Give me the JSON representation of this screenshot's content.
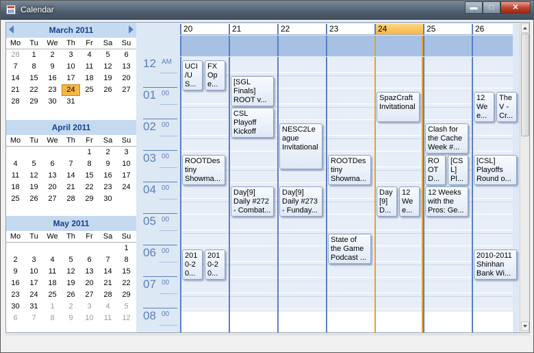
{
  "window": {
    "title": "Calendar",
    "minimize": "▬",
    "maximize": "□",
    "close": "✕"
  },
  "minicals": [
    {
      "title": "March  2011",
      "dow": [
        "Mo",
        "Tu",
        "We",
        "Th",
        "Fr",
        "Sa",
        "Su"
      ],
      "weeks": [
        [
          "28",
          "1",
          "2",
          "3",
          "4",
          "5",
          "6"
        ],
        [
          "7",
          "8",
          "9",
          "10",
          "11",
          "12",
          "13"
        ],
        [
          "14",
          "15",
          "16",
          "17",
          "18",
          "19",
          "20"
        ],
        [
          "21",
          "22",
          "23",
          "24",
          "25",
          "26",
          "27"
        ],
        [
          "28",
          "29",
          "30",
          "31",
          "",
          "",
          ""
        ]
      ],
      "gray_first_week_leading": 1,
      "today": "24"
    },
    {
      "title": "April  2011",
      "dow": [
        "Mo",
        "Tu",
        "We",
        "Th",
        "Fr",
        "Sa",
        "Su"
      ],
      "weeks": [
        [
          "",
          "",
          "",
          "",
          "1",
          "2",
          "3"
        ],
        [
          "4",
          "5",
          "6",
          "7",
          "8",
          "9",
          "10"
        ],
        [
          "11",
          "12",
          "13",
          "14",
          "15",
          "16",
          "17"
        ],
        [
          "18",
          "19",
          "20",
          "21",
          "22",
          "23",
          "24"
        ],
        [
          "25",
          "26",
          "27",
          "28",
          "29",
          "30",
          ""
        ]
      ]
    },
    {
      "title": "May  2011",
      "dow": [
        "Mo",
        "Tu",
        "We",
        "Th",
        "Fr",
        "Sa",
        "Su"
      ],
      "weeks": [
        [
          "",
          "",
          "",
          "",
          "",
          "",
          "1"
        ],
        [
          "2",
          "3",
          "4",
          "5",
          "6",
          "7",
          "8"
        ],
        [
          "9",
          "10",
          "11",
          "12",
          "13",
          "14",
          "15"
        ],
        [
          "16",
          "17",
          "18",
          "19",
          "20",
          "21",
          "22"
        ],
        [
          "23",
          "24",
          "25",
          "26",
          "27",
          "28",
          "29"
        ],
        [
          "30",
          "31",
          "1",
          "2",
          "3",
          "4",
          "5"
        ],
        [
          "6",
          "7",
          "8",
          "9",
          "10",
          "11",
          "12"
        ]
      ]
    }
  ],
  "days": [
    {
      "label": "20",
      "today": false
    },
    {
      "label": "21",
      "today": false
    },
    {
      "label": "22",
      "today": false
    },
    {
      "label": "23",
      "today": false
    },
    {
      "label": "24",
      "today": true
    },
    {
      "label": "25",
      "today": false
    },
    {
      "label": "26",
      "today": false
    }
  ],
  "hours": [
    {
      "hour": "12",
      "suffix": "AM"
    },
    {
      "hour": "01",
      "suffix": "00"
    },
    {
      "hour": "02",
      "suffix": "00"
    },
    {
      "hour": "03",
      "suffix": "00"
    },
    {
      "hour": "04",
      "suffix": "00"
    },
    {
      "hour": "05",
      "suffix": "00"
    },
    {
      "hour": "06",
      "suffix": "00"
    },
    {
      "hour": "07",
      "suffix": "00"
    },
    {
      "hour": "08",
      "suffix": "00"
    }
  ],
  "events": [
    {
      "day": 0,
      "start": 0,
      "dur": 2,
      "lane": 0,
      "lanes": 2,
      "text": "UCI /U S..."
    },
    {
      "day": 0,
      "start": 0,
      "dur": 2,
      "lane": 1,
      "lanes": 2,
      "text": "FX Op e..."
    },
    {
      "day": 1,
      "start": 1,
      "dur": 2,
      "lane": 0,
      "lanes": 1,
      "text": "[SGL Finals] ROOT v..."
    },
    {
      "day": 1,
      "start": 3,
      "dur": 2,
      "lane": 0,
      "lanes": 1,
      "text": "CSL Playoff Kickoff"
    },
    {
      "day": 2,
      "start": 4,
      "dur": 3,
      "lane": 0,
      "lanes": 1,
      "text": "NESC2Le ague Invitational"
    },
    {
      "day": 4,
      "start": 2,
      "dur": 2,
      "lane": 0,
      "lanes": 1,
      "text": "SpazCraft Invitational"
    },
    {
      "day": 5,
      "start": 4,
      "dur": 2,
      "lane": 0,
      "lanes": 1,
      "text": "Clash for the Cache Week #..."
    },
    {
      "day": 6,
      "start": 2,
      "dur": 2,
      "lane": 0,
      "lanes": 2,
      "text": "12 We e..."
    },
    {
      "day": 6,
      "start": 2,
      "dur": 2,
      "lane": 1,
      "lanes": 2,
      "text": "The V - Cr..."
    },
    {
      "day": 0,
      "start": 6,
      "dur": 2,
      "lane": 0,
      "lanes": 1,
      "text": "ROOTDes tiny Showma..."
    },
    {
      "day": 3,
      "start": 6,
      "dur": 2,
      "lane": 0,
      "lanes": 1,
      "text": "ROOTDes tiny Showma..."
    },
    {
      "day": 5,
      "start": 6,
      "dur": 2,
      "lane": 0,
      "lanes": 2,
      "text": "RO OT D..."
    },
    {
      "day": 5,
      "start": 6,
      "dur": 2,
      "lane": 1,
      "lanes": 2,
      "text": "[CS L] Pl..."
    },
    {
      "day": 6,
      "start": 6,
      "dur": 2,
      "lane": 0,
      "lanes": 1,
      "text": "[CSL] Playoffs Round o..."
    },
    {
      "day": 1,
      "start": 8,
      "dur": 2,
      "lane": 0,
      "lanes": 1,
      "text": "Day[9] Daily #272 - Combat..."
    },
    {
      "day": 2,
      "start": 8,
      "dur": 2,
      "lane": 0,
      "lanes": 1,
      "text": "Day[9] Daily #273 - Funday..."
    },
    {
      "day": 4,
      "start": 8,
      "dur": 2,
      "lane": 0,
      "lanes": 2,
      "text": "Day [9] D..."
    },
    {
      "day": 4,
      "start": 8,
      "dur": 2,
      "lane": 1,
      "lanes": 2,
      "text": "12 We e..."
    },
    {
      "day": 5,
      "start": 8,
      "dur": 2,
      "lane": 0,
      "lanes": 1,
      "text": "12 Weeks with the Pros: Ge..."
    },
    {
      "day": 3,
      "start": 11,
      "dur": 2,
      "lane": 0,
      "lanes": 1,
      "text": "State of the Game Podcast ..."
    },
    {
      "day": 0,
      "start": 12,
      "dur": 2,
      "lane": 0,
      "lanes": 2,
      "text": "201 0-2 0..."
    },
    {
      "day": 0,
      "start": 12,
      "dur": 2,
      "lane": 1,
      "lanes": 2,
      "text": "201 0-2 0..."
    },
    {
      "day": 6,
      "start": 12,
      "dur": 2,
      "lane": 0,
      "lanes": 1,
      "text": "2010-2011 Shinhan Bank Wi..."
    }
  ]
}
